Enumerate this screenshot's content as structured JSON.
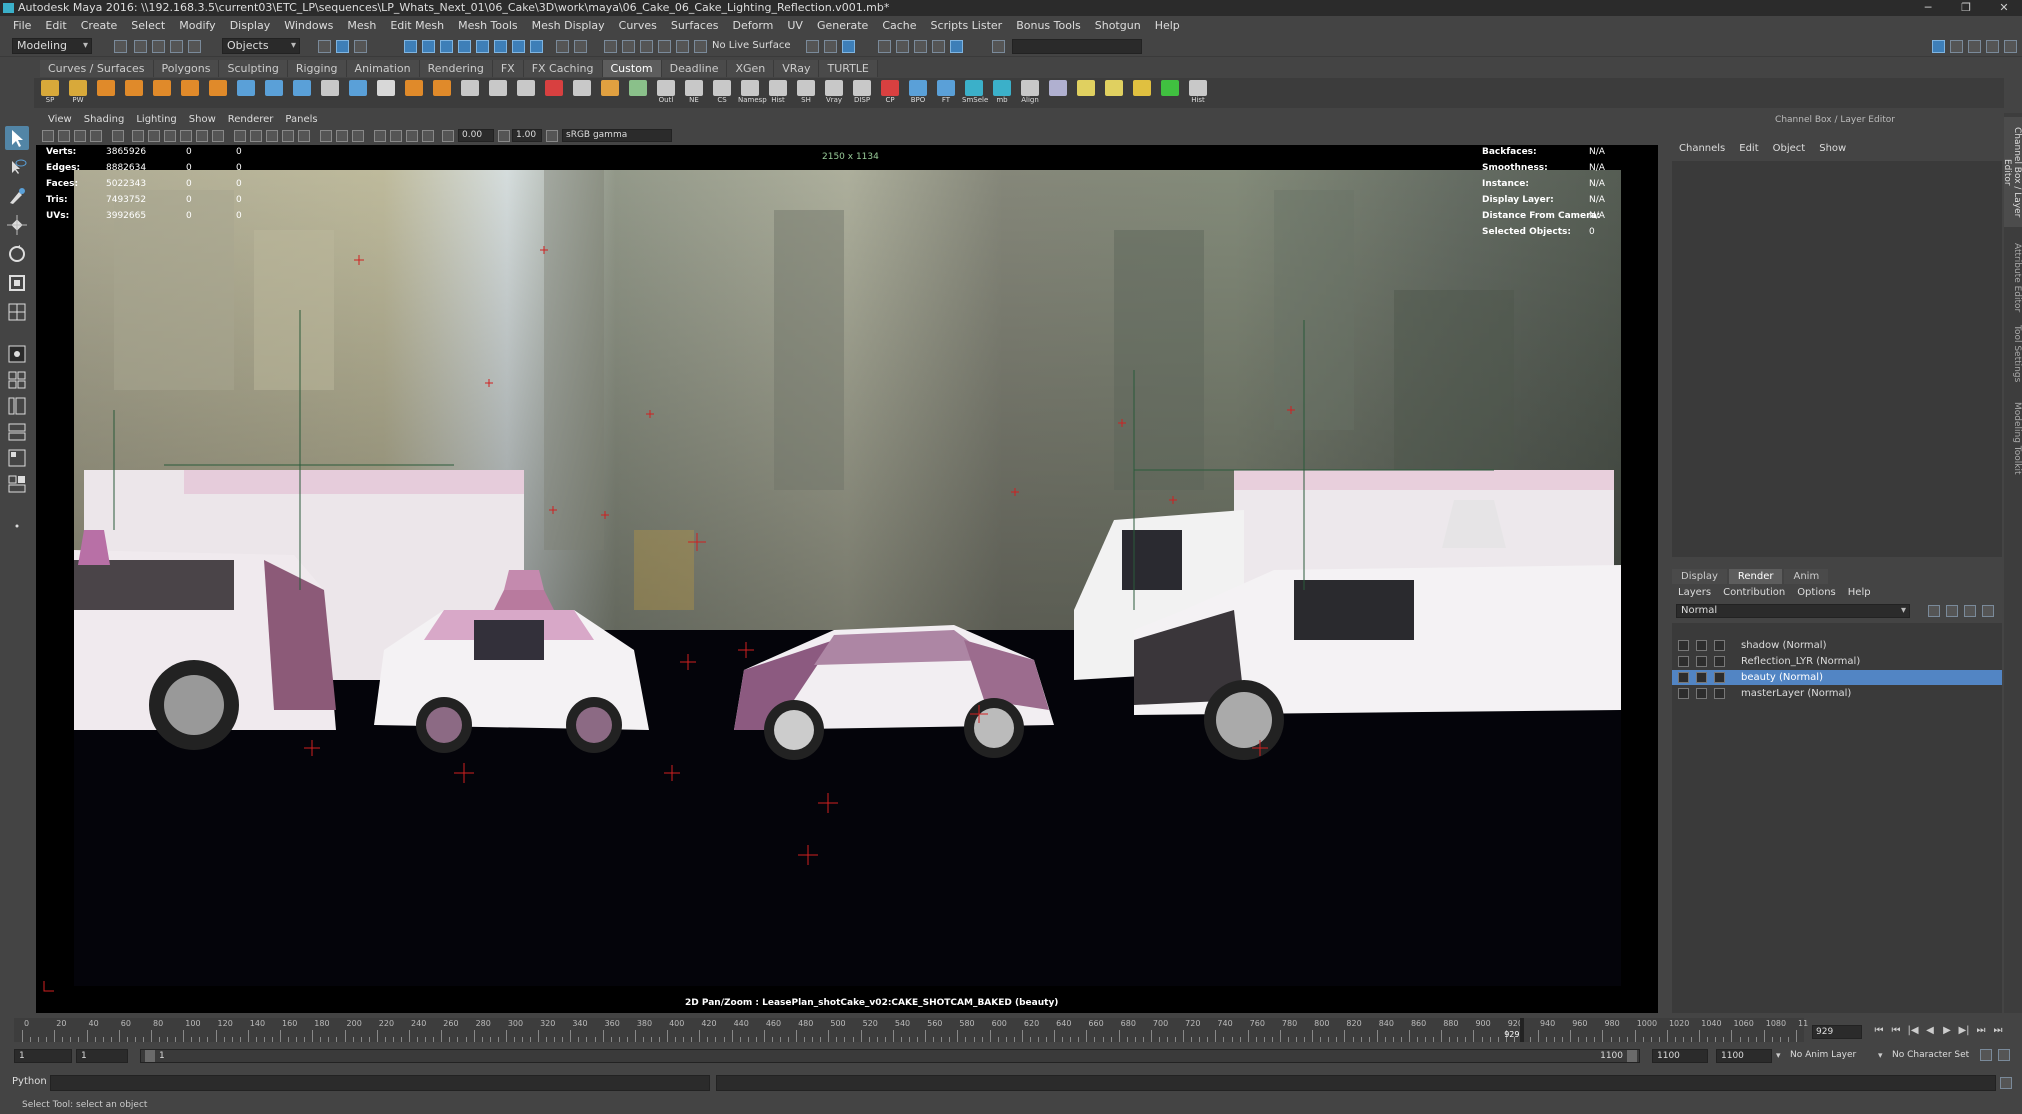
{
  "window": {
    "title": "Autodesk Maya 2016: \\\\192.168.3.5\\current03\\ETC_LP\\sequences\\LP_Whats_Next_01\\06_Cake\\3D\\work\\maya\\06_Cake_06_Cake_Lighting_Reflection.v001.mb*",
    "controls": [
      "─",
      "❐",
      "✕"
    ]
  },
  "menubar": [
    "File",
    "Edit",
    "Create",
    "Select",
    "Modify",
    "Display",
    "Windows",
    "Mesh",
    "Edit Mesh",
    "Mesh Tools",
    "Mesh Display",
    "Curves",
    "Surfaces",
    "Deform",
    "UV",
    "Generate",
    "Cache",
    "Scripts Lister",
    "Bonus Tools",
    "Shotgun",
    "Help"
  ],
  "statusline": {
    "mode": "Modeling",
    "select_mode": "Objects",
    "live_surface": "No Live Surface"
  },
  "shelf_tabs": [
    {
      "label": "Curves / Surfaces",
      "active": false
    },
    {
      "label": "Polygons",
      "active": false
    },
    {
      "label": "Sculpting",
      "active": false
    },
    {
      "label": "Rigging",
      "active": false
    },
    {
      "label": "Animation",
      "active": false
    },
    {
      "label": "Rendering",
      "active": false
    },
    {
      "label": "FX",
      "active": false
    },
    {
      "label": "FX Caching",
      "active": false
    },
    {
      "label": "Custom",
      "active": true
    },
    {
      "label": "Deadline",
      "active": false
    },
    {
      "label": "XGen",
      "active": false
    },
    {
      "label": "VRay",
      "active": false
    },
    {
      "label": "TURTLE",
      "active": false
    }
  ],
  "shelf_icons": [
    {
      "label": "SP",
      "icon": "folder-icon",
      "color": "#d8a93a"
    },
    {
      "label": "PW",
      "icon": "folder-icon",
      "color": "#d8a93a"
    },
    {
      "label": "",
      "icon": "cube-icon",
      "color": "#e08a2a"
    },
    {
      "label": "",
      "icon": "diamond-icon",
      "color": "#e08a2a"
    },
    {
      "label": "",
      "icon": "sphere-icon",
      "color": "#e08a2a"
    },
    {
      "label": "",
      "icon": "cylinder-icon",
      "color": "#e08a2a"
    },
    {
      "label": "",
      "icon": "disc-icon",
      "color": "#e08a2a"
    },
    {
      "label": "",
      "icon": "curve-icon",
      "color": "#5aa0d8"
    },
    {
      "label": "",
      "icon": "curve-icon",
      "color": "#5aa0d8"
    },
    {
      "label": "",
      "icon": "curve-icon",
      "color": "#5aa0d8"
    },
    {
      "label": "",
      "icon": "gear-icon",
      "color": "#c8c8c8"
    },
    {
      "label": "",
      "icon": "star-icon",
      "color": "#5aa0d8"
    },
    {
      "label": "",
      "icon": "mesh-icon",
      "color": "#d8d8d8"
    },
    {
      "label": "",
      "icon": "wrench-icon",
      "color": "#e08a2a"
    },
    {
      "label": "",
      "icon": "wheel-icon",
      "color": "#e08a2a"
    },
    {
      "label": "",
      "icon": "grid-icon",
      "color": "#c8c8c8"
    },
    {
      "label": "",
      "icon": "grid-icon",
      "color": "#c8c8c8"
    },
    {
      "label": "",
      "icon": "pen-icon",
      "color": "#c8c8c8"
    },
    {
      "label": "",
      "icon": "cross-icon",
      "color": "#d84040"
    },
    {
      "label": "",
      "icon": "frame-icon",
      "color": "#c8c8c8"
    },
    {
      "label": "",
      "icon": "globe-icon",
      "color": "#e0a040"
    },
    {
      "label": "",
      "icon": "checker-icon",
      "color": "#8ac08a"
    },
    {
      "label": "Outl",
      "icon": "window-icon",
      "color": "#c8c8c8"
    },
    {
      "label": "NE",
      "icon": "window-icon",
      "color": "#c8c8c8"
    },
    {
      "label": "CS",
      "icon": "window-icon",
      "color": "#c8c8c8"
    },
    {
      "label": "Namesp",
      "icon": "window-icon",
      "color": "#c8c8c8"
    },
    {
      "label": "Hist",
      "icon": "brush-icon",
      "color": "#c8c8c8"
    },
    {
      "label": "SH",
      "icon": "brush-icon",
      "color": "#c8c8c8"
    },
    {
      "label": "Vray",
      "icon": "brush-icon",
      "color": "#c8c8c8"
    },
    {
      "label": "DISP",
      "icon": "brush-icon",
      "color": "#c8c8c8"
    },
    {
      "label": "CP",
      "icon": "joint-icon",
      "color": "#d84040"
    },
    {
      "label": "BPO",
      "icon": "joint-icon",
      "color": "#5aa0d8"
    },
    {
      "label": "FT",
      "icon": "joint-icon",
      "color": "#5aa0d8"
    },
    {
      "label": "SmSele",
      "icon": "crown-icon",
      "color": "#3bb0c9"
    },
    {
      "label": "mb",
      "icon": "crown-icon",
      "color": "#3bb0c9"
    },
    {
      "label": "Align",
      "icon": "person-icon",
      "color": "#c8c8c8"
    },
    {
      "label": "",
      "icon": "render-icon",
      "color": "#b0b0d0"
    },
    {
      "label": "",
      "icon": "light-icon",
      "color": "#e0d060"
    },
    {
      "label": "",
      "icon": "dome-icon",
      "color": "#e0d060"
    },
    {
      "label": "",
      "icon": "funnel-icon",
      "color": "#e0c040"
    },
    {
      "label": "",
      "icon": "export-icon",
      "color": "#40c040"
    },
    {
      "label": "Hist",
      "icon": "brush-icon",
      "color": "#c8c8c8"
    }
  ],
  "viewport": {
    "menu": [
      "View",
      "Shading",
      "Lighting",
      "Show",
      "Renderer",
      "Panels"
    ],
    "exposure": "0.00",
    "gamma": "1.00",
    "colorspace": "sRGB gamma",
    "resolution_label": "2150 x 1134",
    "camera_label": "2D Pan/Zoom : LeasePlan_shotCake_v02:CAKE_SHOTCAM_BAKED (beauty)",
    "hud_left": [
      {
        "label": "Verts:",
        "v1": "3865926",
        "v2": "0",
        "v3": "0"
      },
      {
        "label": "Edges:",
        "v1": "8882634",
        "v2": "0",
        "v3": "0"
      },
      {
        "label": "Faces:",
        "v1": "5022343",
        "v2": "0",
        "v3": "0"
      },
      {
        "label": "Tris:",
        "v1": "7493752",
        "v2": "0",
        "v3": "0"
      },
      {
        "label": "UVs:",
        "v1": "3992665",
        "v2": "0",
        "v3": "0"
      }
    ],
    "hud_right": [
      {
        "label": "Backfaces:",
        "value": "N/A"
      },
      {
        "label": "Smoothness:",
        "value": "N/A"
      },
      {
        "label": "Instance:",
        "value": "N/A"
      },
      {
        "label": "Display Layer:",
        "value": "N/A"
      },
      {
        "label": "Distance From Camera:",
        "value": "N/A"
      },
      {
        "label": "Selected Objects:",
        "value": "0"
      }
    ]
  },
  "channel_box": {
    "title": "Channel Box / Layer Editor",
    "menu": [
      "Channels",
      "Edit",
      "Object",
      "Show"
    ]
  },
  "layer_editor": {
    "tabs": [
      {
        "label": "Display",
        "active": false
      },
      {
        "label": "Render",
        "active": true
      },
      {
        "label": "Anim",
        "active": false
      }
    ],
    "menu": [
      "Layers",
      "Contribution",
      "Options",
      "Help"
    ],
    "blend_mode": "Normal",
    "layers": [
      {
        "name": "shadow (Normal)",
        "selected": false
      },
      {
        "name": "Reflection_LYR (Normal)",
        "selected": false
      },
      {
        "name": "beauty (Normal)",
        "selected": true
      },
      {
        "name": "masterLayer (Normal)",
        "selected": false
      }
    ]
  },
  "side_tabs": [
    "Channel Box / Layer Editor",
    "Attribute Editor",
    "Tool Settings",
    "Modeling Toolkit"
  ],
  "timeline": {
    "ticks": [
      "0",
      "20",
      "40",
      "60",
      "80",
      "100",
      "120",
      "140",
      "160",
      "180",
      "200",
      "220",
      "240",
      "260",
      "280",
      "300",
      "320",
      "340",
      "360",
      "380",
      "400",
      "420",
      "440",
      "460",
      "480",
      "500",
      "520",
      "540",
      "560",
      "580",
      "600",
      "620",
      "640",
      "660",
      "680",
      "700",
      "720",
      "740",
      "760",
      "780",
      "800",
      "820",
      "840",
      "860",
      "880",
      "900",
      "920",
      "940",
      "960",
      "980",
      "1000",
      "1020",
      "1040",
      "1060",
      "1080",
      "11"
    ],
    "current_frame": "929",
    "current_frame_field": "929",
    "playback_buttons": [
      "⏮",
      "⏮",
      "|◀",
      "◀",
      "▶",
      "▶|",
      "⏭",
      "⏭"
    ]
  },
  "range": {
    "start": "1",
    "playback_start": "1",
    "slider_start": "1",
    "slider_end": "1100",
    "playback_end": "1100",
    "end": "1100",
    "anim_layer": "No Anim Layer",
    "character_set": "No Character Set"
  },
  "command": {
    "language": "Python",
    "help": "Select Tool: select an object"
  },
  "colors": {
    "accent": "#5285c4",
    "active_tool": "#5285a6",
    "maya_teal": "#3bb0c9",
    "marker_red": "#d02020"
  }
}
